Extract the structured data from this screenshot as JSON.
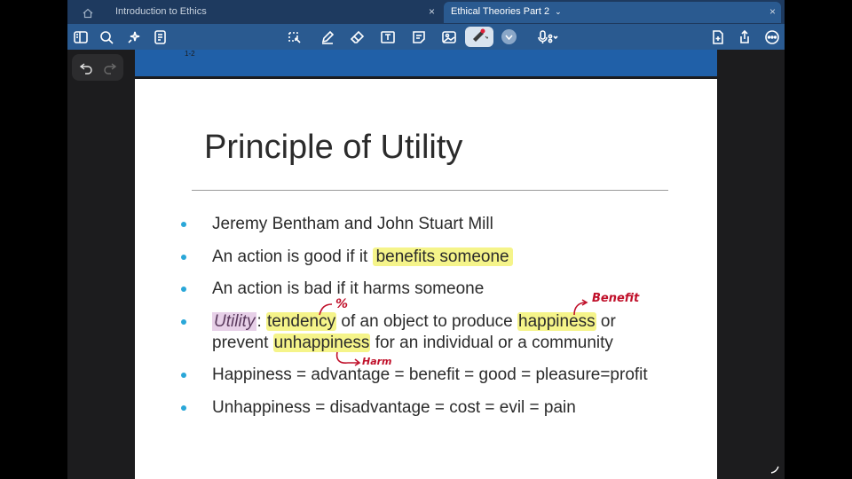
{
  "tabs": [
    {
      "label": "Introduction to Ethics",
      "active": false
    },
    {
      "label": "Ethical Theories Part 2",
      "active": true
    }
  ],
  "toolbar": {
    "left_icons": [
      "sidebar-icon",
      "search-icon",
      "sparkle-icon",
      "notes-icon"
    ],
    "center_icons": [
      "lasso-icon",
      "pen-icon",
      "eraser-icon",
      "text-box-icon",
      "sticky-note-icon",
      "image-icon",
      "laser-pen-icon",
      "color-picker-icon",
      "microphone-icon"
    ],
    "right_icons": [
      "add-page-icon",
      "share-icon",
      "more-icon"
    ]
  },
  "page_number": "1-2",
  "slide": {
    "title": "Principle of Utility",
    "bullets": [
      {
        "pre": "Jeremy Bentham and John Stuart Mill"
      },
      {
        "pre": "An action is good if it ",
        "hl": "benefits someone"
      },
      {
        "pre": "An action is bad if it harms someone"
      },
      {
        "term": "Utility",
        "colon": ": ",
        "w1": "tendency",
        "mid": " of an object to produce ",
        "w2": "happiness",
        "tail": " or",
        "line2_pre": "prevent ",
        "w3": "unhappiness",
        "line2_tail": " for an individual or a community"
      },
      {
        "pre": "Happiness = advantage = benefit = good = pleasure=profit"
      },
      {
        "pre": "Unhappiness = disadvantage = cost = evil = pain"
      }
    ],
    "annotations": {
      "percent": "%",
      "benefit": "Benefit",
      "harm": "Harm"
    }
  },
  "colors": {
    "toolbar": "#2a5a90",
    "tabbar": "#1e3a5f",
    "highlight": "#f5f48a",
    "bullet": "#2aa7d8",
    "ink": "#c0102a"
  }
}
